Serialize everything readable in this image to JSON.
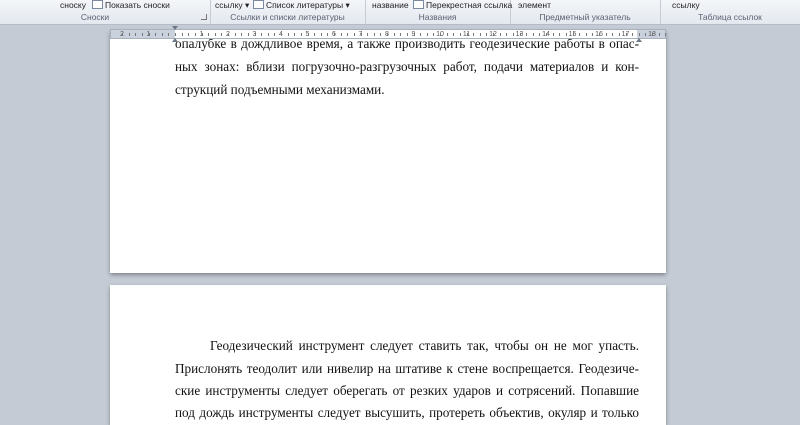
{
  "ribbon": {
    "footnotes": {
      "insert_partial": "сноску",
      "show_footnotes": "Показать сноски",
      "caption": "Сноски"
    },
    "citations": {
      "insert_partial": "ссылку",
      "bibliography": "Список литературы",
      "caption": "Ссылки и списки литературы"
    },
    "captions": {
      "insert_partial": "название",
      "cross_reference": "Перекрестная ссылка",
      "caption": "Названия"
    },
    "index": {
      "mark_partial": "элемент",
      "caption": "Предметный указатель"
    },
    "toa": {
      "mark_partial": "ссылку",
      "caption": "Таблица ссылок"
    }
  },
  "ruler": {
    "labels": [
      "2",
      "1",
      "1",
      "2",
      "3",
      "4",
      "5",
      "6",
      "7",
      "8",
      "9",
      "10",
      "11",
      "12",
      "13",
      "14",
      "15",
      "16",
      "17",
      "18"
    ]
  },
  "page1": {
    "lines": [
      "опалубке в дождливое время, а также производить геодезические работы в опас-",
      "ных зонах: вблизи погрузочно-разгрузочных работ, подачи материалов и кон-",
      "струкций подъемными механизмами."
    ]
  },
  "page2": {
    "lines": [
      "Геодезический инструмент следует ставить так, чтобы он не мог упасть.",
      "Прислонять теодолит или нивелир на штативе к стене воспрещается. Геодезиче-",
      "ские инструменты следует оберегать от резких ударов и сотрясений. Попавшие",
      "под дождь инструменты следует высушить, протереть объектив, окуляр и только"
    ]
  }
}
